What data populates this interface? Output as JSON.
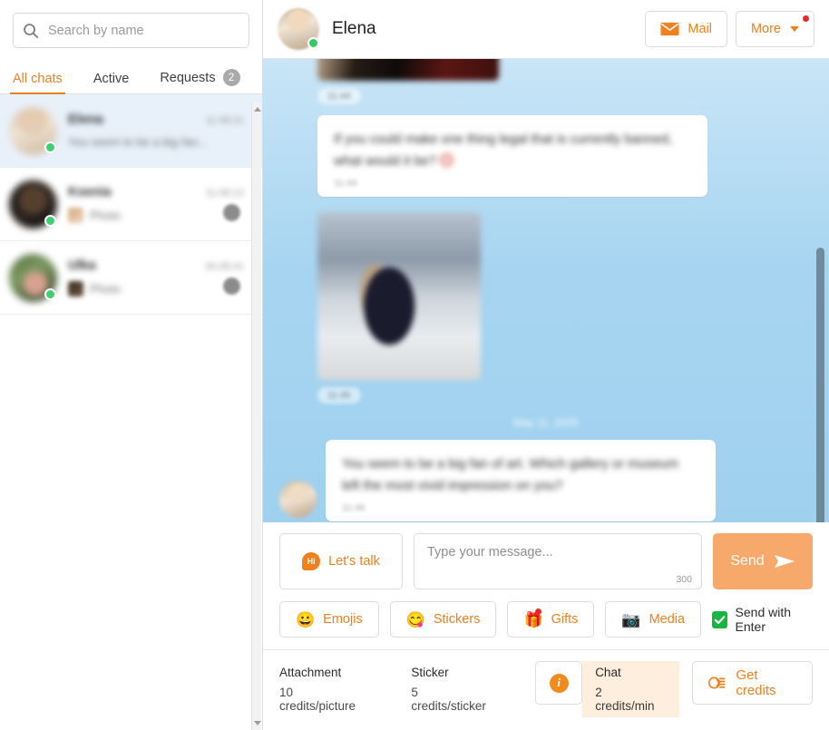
{
  "sidebar": {
    "search": {
      "placeholder": "Search by name",
      "value": "",
      "icon": "search-icon"
    },
    "tabs": [
      {
        "label": "All chats",
        "active": true,
        "badge": null
      },
      {
        "label": "Active",
        "active": false,
        "badge": null
      },
      {
        "label": "Requests",
        "active": false,
        "badge": "2"
      }
    ],
    "chats": [
      {
        "name": "Elena",
        "time": "11:46:21",
        "preview": "You seem to be a big fan...",
        "selected": true,
        "online": true,
        "has_thumb": false,
        "unread_badge": false
      },
      {
        "name": "Ksenia",
        "time": "11:46:12",
        "preview": "Photo",
        "selected": false,
        "online": true,
        "has_thumb": true,
        "unread_badge": true
      },
      {
        "name": "Ulka",
        "time": "30.08.41",
        "preview": "Photo",
        "selected": false,
        "online": true,
        "has_thumb": true,
        "unread_badge": true
      }
    ]
  },
  "header": {
    "contact_name": "Elena",
    "online": true,
    "mail_label": "Mail",
    "more_label": "More",
    "more_has_notification": true
  },
  "conversation": {
    "date_separator": "May 11, 2025",
    "messages": [
      {
        "type": "photo",
        "variant": "top",
        "time": "11:44"
      },
      {
        "type": "text",
        "text": "If you could make one thing legal that is currently banned, what would it be?",
        "time": "11:44",
        "has_emoji": true
      },
      {
        "type": "photo",
        "variant": "beach",
        "time": "11:45"
      },
      {
        "type": "text",
        "text": "You seem to be a big fan of art. Which gallery or museum left the most vivid impression on you?",
        "time": "11:46",
        "has_avatar": true
      }
    ]
  },
  "compose": {
    "lets_talk_label": "Let's talk",
    "lets_talk_icon_text": "Hi",
    "input_placeholder": "Type your message...",
    "input_value": "",
    "char_limit": "300",
    "send_label": "Send",
    "tools": [
      {
        "label": "Emojis",
        "icon": "😀",
        "icon_name": "emoji-face-icon",
        "dot": false
      },
      {
        "label": "Stickers",
        "icon": "😋",
        "icon_name": "sticker-icon",
        "dot": false
      },
      {
        "label": "Gifts",
        "icon": "🎁",
        "icon_name": "gift-icon",
        "dot": true
      },
      {
        "label": "Media",
        "icon": "📷",
        "icon_name": "camera-icon",
        "dot": false
      }
    ],
    "send_with_enter_label": "Send with Enter",
    "send_with_enter_checked": true
  },
  "credits": {
    "attachment_title": "Attachment",
    "attachment_rate": "10 credits/picture",
    "sticker_title": "Sticker",
    "sticker_rate": "5 credits/sticker",
    "chat_title": "Chat",
    "chat_rate": "2 credits/min",
    "get_credits_label": "Get credits",
    "info_glyph": "i"
  },
  "colors": {
    "accent": "#ef7f1a",
    "send_button": "#f6a96a",
    "chat_bg_top": "#c9e5f7",
    "chat_bg_bottom": "#9fd1ef",
    "selected_row": "#e8f1fa",
    "online_green": "#3ecf6e",
    "notification_red": "#e42b2b",
    "checkbox_green": "#18b541",
    "cost_highlight": "#fdeedd"
  }
}
